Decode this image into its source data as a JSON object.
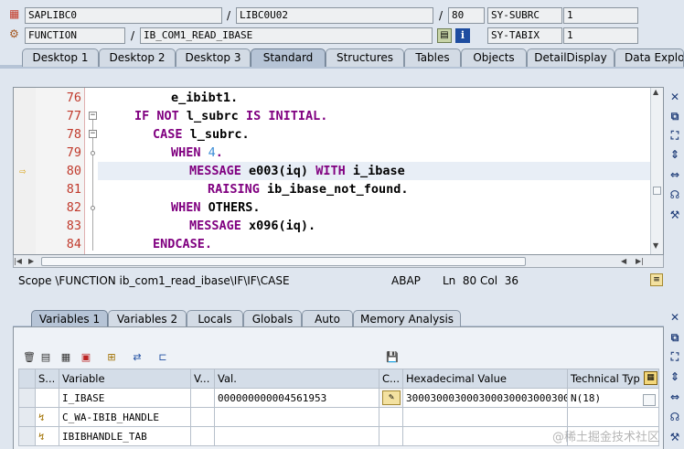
{
  "header": {
    "program": "SAPLIBC0",
    "include": "LIBC0U02",
    "line": "80",
    "sy_subrc_label": "SY-SUBRC",
    "sy_subrc_value": "1",
    "event_type": "FUNCTION",
    "event_name": "IB_COM1_READ_IBASE",
    "sy_tabix_label": "SY-TABIX",
    "sy_tabix_value": "1",
    "slash": "/"
  },
  "main_tabs": [
    {
      "label": "Desktop 1"
    },
    {
      "label": "Desktop 2"
    },
    {
      "label": "Desktop 3"
    },
    {
      "label": "Standard"
    },
    {
      "label": "Structures"
    },
    {
      "label": "Tables"
    },
    {
      "label": "Objects"
    },
    {
      "label": "DetailDisplay"
    },
    {
      "label": "Data Explorer"
    }
  ],
  "code": {
    "lines": [
      {
        "num": "76"
      },
      {
        "num": "77"
      },
      {
        "num": "78"
      },
      {
        "num": "79"
      },
      {
        "num": "80"
      },
      {
        "num": "81"
      },
      {
        "num": "82"
      },
      {
        "num": "83"
      },
      {
        "num": "84"
      }
    ],
    "t": {
      "l76": "e_ibibt1.",
      "l77a": "IF NOT",
      "l77b": " l_subrc ",
      "l77c": "IS INITIAL",
      "l77d": ".",
      "l78a": "CASE",
      "l78b": " l_subrc.",
      "l79a": "WHEN",
      "l79b": " 4",
      "l79c": ".",
      "l80a": "MESSAGE",
      "l80b": " e003(iq) ",
      "l80c": "WITH",
      "l80d": " i_ibase",
      "l81a": "RAISING",
      "l81b": " ib_ibase_not_found.",
      "l82a": "WHEN",
      "l82b": " OTHERS.",
      "l83a": "MESSAGE",
      "l83b": " x096(iq).",
      "l84a": "ENDCASE",
      "l84b": "."
    }
  },
  "status": {
    "scope": "Scope \\FUNCTION ib_com1_read_ibase\\IF\\IF\\CASE",
    "language": "ABAP",
    "position": "Ln  80 Col  36"
  },
  "var_tabs": [
    {
      "label": "Variables 1"
    },
    {
      "label": "Variables 2"
    },
    {
      "label": "Locals"
    },
    {
      "label": "Globals"
    },
    {
      "label": "Auto"
    },
    {
      "label": "Memory Analysis"
    }
  ],
  "grid": {
    "columns": [
      "S...",
      "Variable",
      "V...",
      "Val.",
      "C...",
      "Hexadecimal Value",
      "Technical Typ"
    ],
    "rows": [
      {
        "variable": "I_IBASE",
        "value": "000000000004561953",
        "hex": "30003000300030003000300030003000...",
        "type": "N(18)"
      },
      {
        "variable": "C_WA-IBIB_HANDLE",
        "value": "",
        "hex": "",
        "type": ""
      },
      {
        "variable": "IBIBHANDLE_TAB",
        "value": "",
        "hex": "",
        "type": ""
      }
    ]
  },
  "watermark": "@稀土掘金技术社区",
  "colors": {
    "keyword": "#800080",
    "line_number": "#c0392b",
    "number": "#3b8cd6",
    "current_line": "#e8eef6"
  }
}
